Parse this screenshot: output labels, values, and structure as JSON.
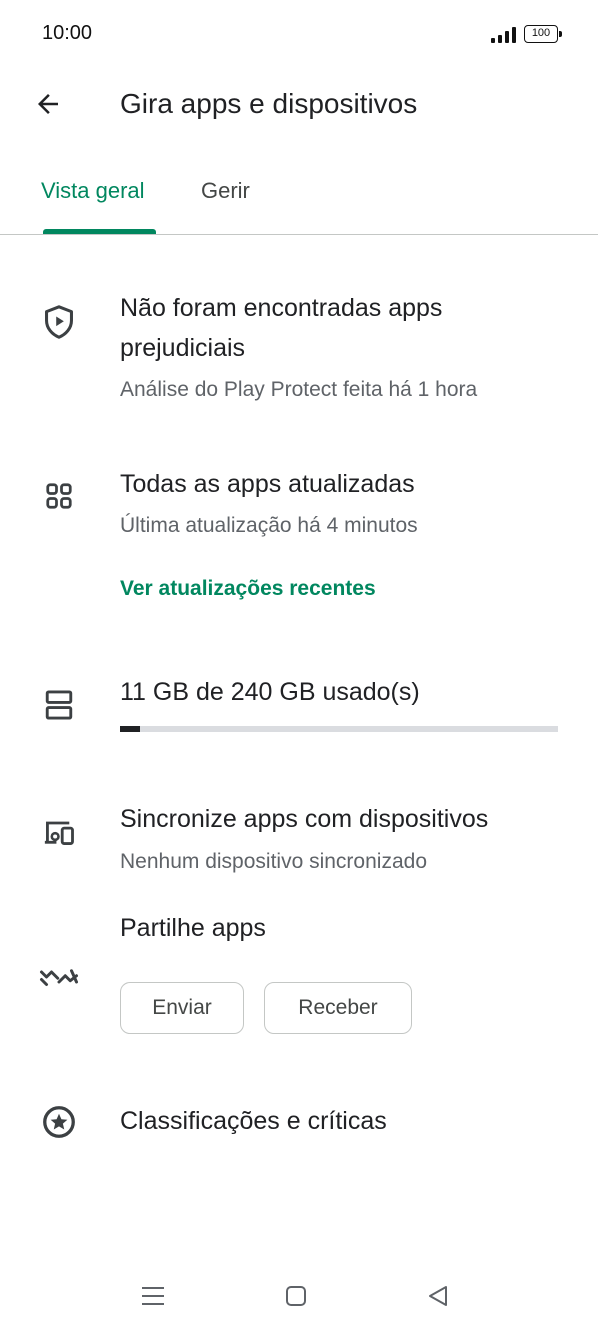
{
  "status_bar": {
    "time": "10:00",
    "battery": "100"
  },
  "app_bar": {
    "title": "Gira apps e dispositivos",
    "back_icon": "arrow-back-icon"
  },
  "tabs": [
    {
      "label": "Vista geral",
      "selected": true
    },
    {
      "label": "Gerir",
      "selected": false
    }
  ],
  "protect": {
    "icon": "shield-play-icon",
    "title": "Não foram encontradas apps prejudiciais",
    "subtitle": "Análise do Play Protect feita há 1 hora"
  },
  "updates": {
    "icon": "apps-grid-icon",
    "title": "Todas as apps atualizadas",
    "subtitle": "Última atualização há 4 minutos",
    "link": "Ver atualizações recentes"
  },
  "storage": {
    "icon": "storage-icon",
    "label": "11 GB de 240 GB usado(s)",
    "used_fraction": 0.046
  },
  "sync": {
    "icon": "devices-icon",
    "title": "Sincronize apps com dispositivos",
    "subtitle": "Nenhum dispositivo sincronizado"
  },
  "share": {
    "icon": "nearby-share-icon",
    "title": "Partilhe apps",
    "send_label": "Enviar",
    "receive_label": "Receber"
  },
  "ratings": {
    "icon": "star-circle-icon",
    "title": "Classificações e críticas"
  },
  "nav_bar": {
    "menu_icon": "menu-icon",
    "home_icon": "home-square-icon",
    "back_icon": "back-triangle-icon"
  },
  "colors": {
    "accent": "#01875f",
    "text": "#202124",
    "secondary": "#5f6368"
  }
}
